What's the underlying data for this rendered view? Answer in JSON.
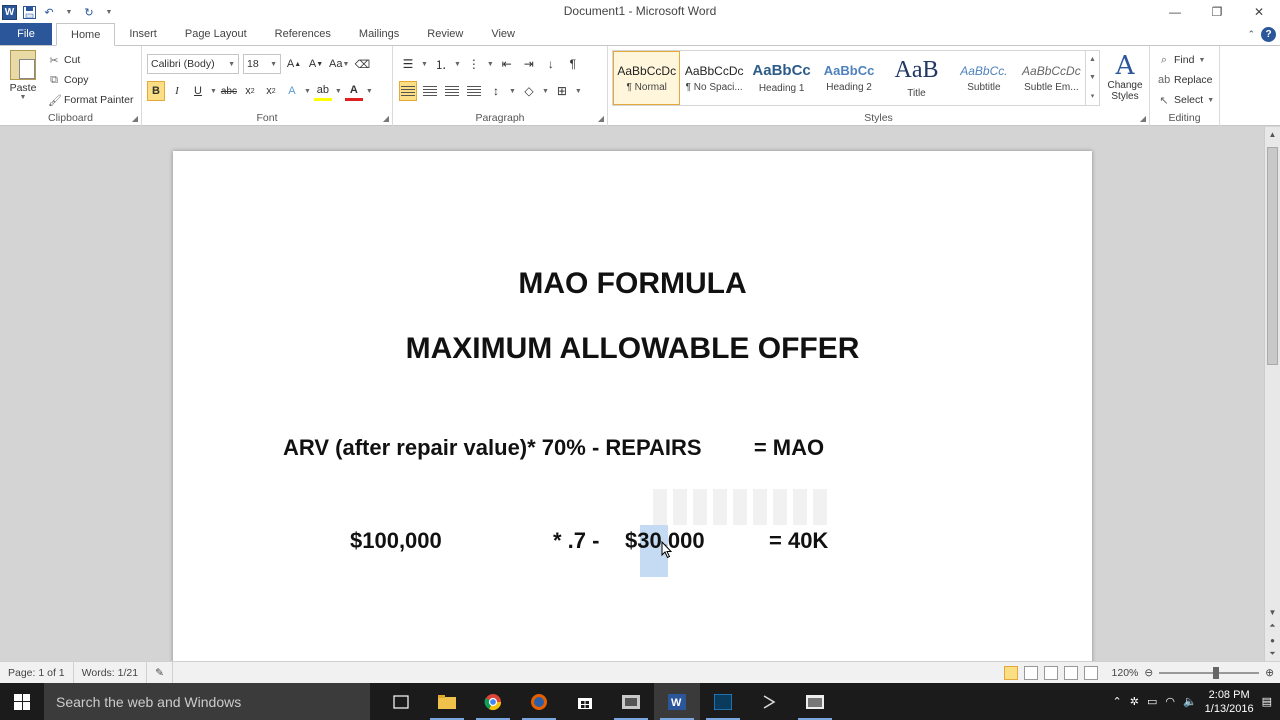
{
  "window": {
    "title": "Document1 - Microsoft Word",
    "app_logo": "W",
    "minimize": "—",
    "restore": "❐",
    "close": "✕"
  },
  "tabs": [
    "File",
    "Home",
    "Insert",
    "Page Layout",
    "References",
    "Mailings",
    "Review",
    "View"
  ],
  "active_tab": "Home",
  "ribbon": {
    "clipboard": {
      "label": "Clipboard",
      "paste": "Paste",
      "cut": "Cut",
      "copy": "Copy",
      "format_painter": "Format Painter"
    },
    "font": {
      "label": "Font",
      "font_name": "Calibri (Body)",
      "font_size": "18"
    },
    "paragraph": {
      "label": "Paragraph"
    },
    "styles": {
      "label": "Styles",
      "items": [
        {
          "sample": "AaBbCcDc",
          "name": "¶ Normal"
        },
        {
          "sample": "AaBbCcDc",
          "name": "¶ No Spaci..."
        },
        {
          "sample": "AaBbCc",
          "name": "Heading 1"
        },
        {
          "sample": "AaBbCc",
          "name": "Heading 2"
        },
        {
          "sample": "AaB",
          "name": "Title"
        },
        {
          "sample": "AaBbCc.",
          "name": "Subtitle"
        },
        {
          "sample": "AaBbCcDc",
          "name": "Subtle Em..."
        }
      ],
      "change_styles": "Change Styles"
    },
    "editing": {
      "label": "Editing",
      "find": "Find",
      "replace": "Replace",
      "select": "Select"
    }
  },
  "document": {
    "title1": "MAO FORMULA",
    "title2": "MAXIMUM ALLOWABLE OFFER",
    "formula_left": "ARV (after repair value)* 70% - REPAIRS",
    "formula_right": "= MAO",
    "calc_arv": "$100,000",
    "calc_mult": "* .7 -",
    "calc_repairs_pre": "$",
    "calc_repairs_sel": "30",
    "calc_repairs_post": ",000",
    "calc_result": "= 40K"
  },
  "status": {
    "page": "Page: 1 of 1",
    "words": "Words: 1/21",
    "zoom": "120%",
    "zoom_level_percent": 120
  },
  "taskbar": {
    "search_placeholder": "Search the web and Windows",
    "time": "2:08 PM",
    "date": "1/13/2016"
  },
  "colors": {
    "accent": "#2b579a",
    "selection": "#b7d4f0",
    "active_style": "#fcdf84"
  }
}
